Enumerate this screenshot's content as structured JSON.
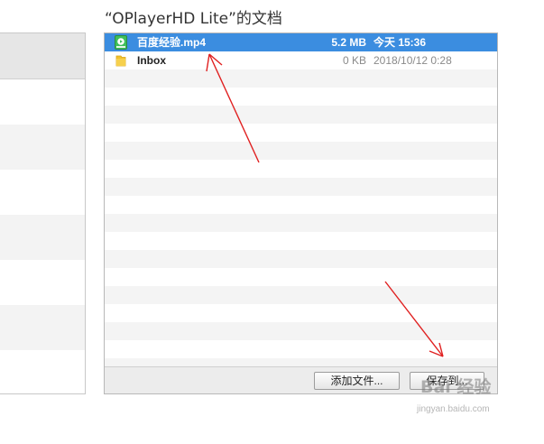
{
  "window": {
    "title": "“OPlayerHD Lite”的文档"
  },
  "files": [
    {
      "icon": "video-file-icon",
      "name": "百度经验.mp4",
      "size": "5.2 MB",
      "date": "今天 15:36",
      "selected": true
    },
    {
      "icon": "folder-icon",
      "name": "Inbox",
      "size": "0 KB",
      "date": "2018/10/12 0:28",
      "selected": false
    }
  ],
  "buttons": {
    "add_file": "添加文件...",
    "save_to": "保存到..."
  },
  "watermark": {
    "brand": "Bai 经验",
    "url": "jingyan.baidu.com"
  },
  "colors": {
    "selection": "#3b8de0",
    "annotation_arrow": "#e02020"
  }
}
